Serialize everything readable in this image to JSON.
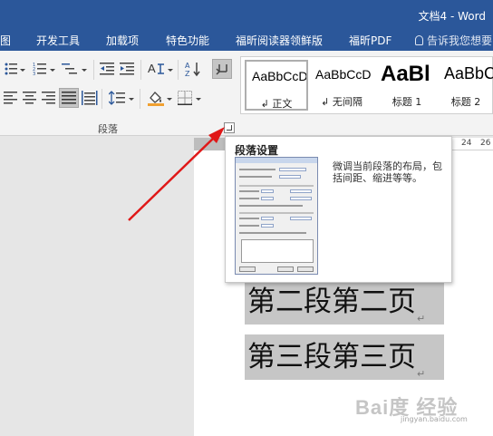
{
  "window": {
    "title": "文档4 - Word"
  },
  "tabs": [
    "图",
    "开发工具",
    "加载项",
    "特色功能",
    "福昕阅读器领鲜版",
    "福昕PDF"
  ],
  "tell_me": {
    "text": "告诉我您想要"
  },
  "ribbon": {
    "group_label": "段落"
  },
  "styles": [
    {
      "sample": "AaBbCcD",
      "name": "↲ 正文"
    },
    {
      "sample": "AaBbCcD",
      "name": "↲ 无间隔"
    },
    {
      "sample": "AaBl",
      "name": "标题 1"
    },
    {
      "sample": "AaBbC",
      "name": "标题 2"
    }
  ],
  "ruler": {
    "ticks": [
      "24",
      "26"
    ]
  },
  "tooltip": {
    "title": "段落设置",
    "description": "微调当前段落的布局，包括间距、缩进等等。"
  },
  "document": {
    "lines": [
      "第二段第二页",
      "第三段第三页"
    ]
  },
  "watermark": {
    "text": "Bai度 经验",
    "sub": "jingyan.baidu.com"
  }
}
